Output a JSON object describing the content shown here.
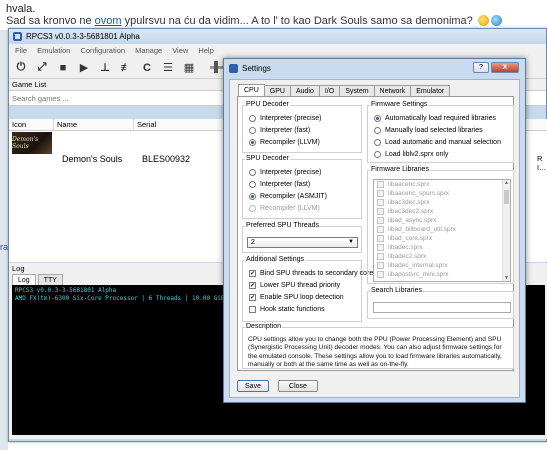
{
  "forum": {
    "line1": "hvala.",
    "line2_before": "Sad sa kronvo ne ",
    "line2_link": "ovom",
    "line2_after": " ypulrsvu na ću da vidim... A to l' to kao Dark Souls samo sa demonima? "
  },
  "sidebar_fragment": "ra",
  "main_window": {
    "title": "RPCS3 v0.0.3-3-5681801 Alpha",
    "menu": [
      "File",
      "Emulation",
      "Configuration",
      "Manage",
      "View",
      "Help"
    ],
    "toolbar_icons": [
      "power-icon",
      "expand-icon",
      "stop-icon",
      "play-icon",
      "cog-icon",
      "sliders-icon",
      "refresh-icon",
      "list-icon",
      "grid-icon"
    ],
    "game_list_label": "Game List",
    "search_placeholder": "Search games ...",
    "columns": [
      "Icon",
      "Name",
      "Serial"
    ],
    "games": [
      {
        "cover": "Demon's Souls",
        "name": "Demon's Souls",
        "serial": "BLES00932",
        "right_fragment": "R I..."
      }
    ],
    "log_label": "Log",
    "log_tabs": [
      "Log",
      "TTY"
    ],
    "log_lines": [
      "RPCS3 v0.0.3-3-5681801 Alpha",
      "AMD FX(tm)-6300 Six-Core Processor | 6 Threads | 10.00 GiB RAM | AVX"
    ]
  },
  "settings": {
    "title": "Settings",
    "help_label": "?",
    "close_label": "X",
    "tabs": [
      "CPU",
      "GPU",
      "Audio",
      "I/O",
      "System",
      "Network",
      "Emulator"
    ],
    "ppu": {
      "title": "PPU Decoder",
      "options": [
        {
          "label": "Interpreter (precise)",
          "checked": false,
          "disabled": false
        },
        {
          "label": "Interpreter (fast)",
          "checked": false,
          "disabled": false
        },
        {
          "label": "Recompiler (LLVM)",
          "checked": true,
          "disabled": false
        }
      ]
    },
    "spu": {
      "title": "SPU Decoder",
      "options": [
        {
          "label": "Interpreter (precise)",
          "checked": false,
          "disabled": false
        },
        {
          "label": "Interpreter (fast)",
          "checked": false,
          "disabled": false
        },
        {
          "label": "Recompiler (ASMJIT)",
          "checked": true,
          "disabled": false
        },
        {
          "label": "Recompiler (LLVM)",
          "checked": false,
          "disabled": true
        }
      ]
    },
    "threads": {
      "title": "Preferred SPU Threads",
      "value": "2"
    },
    "additional": {
      "title": "Additional Settings",
      "options": [
        {
          "label": "Bind SPU threads to secondary cores",
          "checked": true
        },
        {
          "label": "Lower SPU thread priority",
          "checked": true
        },
        {
          "label": "Enable SPU loop detection",
          "checked": true
        },
        {
          "label": "Hook static functions",
          "checked": false
        }
      ]
    },
    "firmware": {
      "title": "Firmware Settings",
      "options": [
        {
          "label": "Automatically load required libraries",
          "checked": true
        },
        {
          "label": "Manually load selected libraries",
          "checked": false
        },
        {
          "label": "Load automatic and manual selection",
          "checked": false
        },
        {
          "label": "Load liblv2.sprx only",
          "checked": false
        }
      ]
    },
    "libraries": {
      "title": "Firmware Libraries",
      "items": [
        "libaacenc.sprx",
        "libaacenc_spurs.sprx",
        "libac3dec.sprx",
        "libac3dec2.sprx",
        "libad_async.sprx",
        "libad_billboard_util.sprx",
        "libad_core.sprx",
        "libadec.sprx",
        "libadec2.sprx",
        "libadec_internal.sprx",
        "libapostsrc_mini.sprx"
      ]
    },
    "search_libraries_title": "Search Libraries",
    "description": {
      "title": "Description",
      "text": "CPU settings allow you to change both the PPU (Power Processing Element) and SPU (Synergistic Processing Unit) decoder modes. You can also adjust firmware settings for the emulated console. These settings allow you to load firmware libraries automatically, manually or both at the same time as well as on-the-fly."
    },
    "save_label": "Save",
    "close_button_label": "Close"
  }
}
